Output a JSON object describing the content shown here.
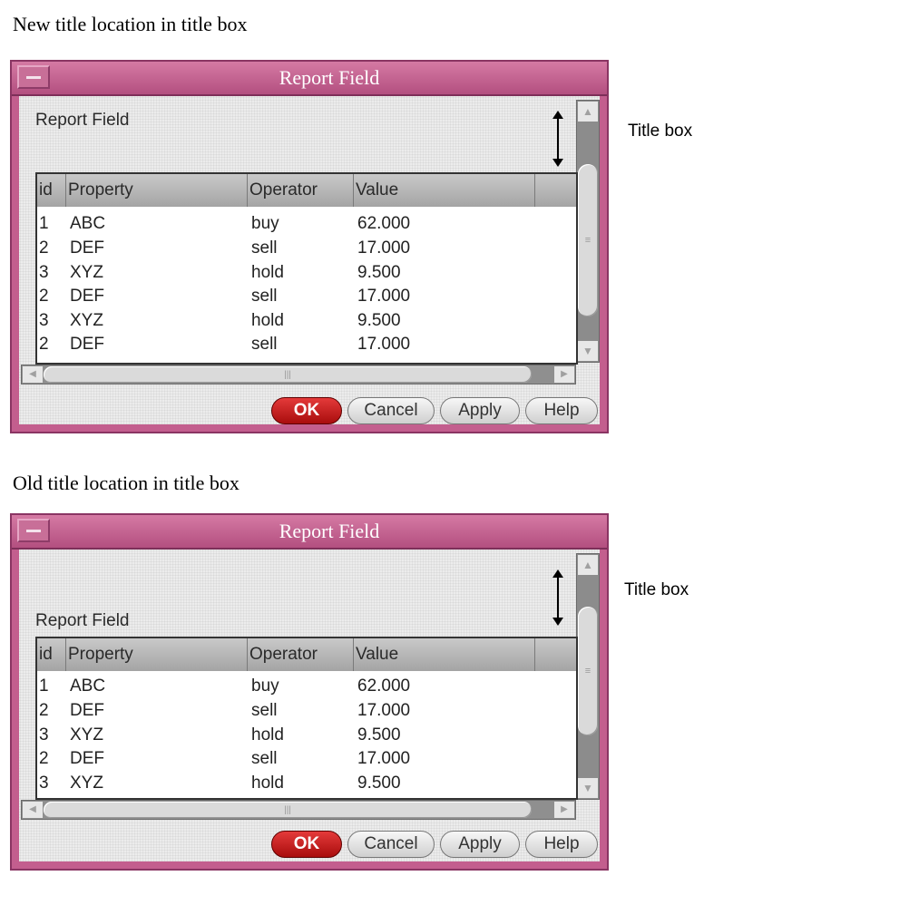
{
  "top": {
    "caption": "New title location in title box",
    "side_label": "Title box",
    "window_title": "Report Field",
    "report_label": "Report Field",
    "columns": [
      "id",
      "Property",
      "Operator",
      "Value"
    ],
    "rows": [
      [
        "1",
        "ABC",
        "buy",
        "62.000"
      ],
      [
        "2",
        "DEF",
        "sell",
        "17.000"
      ],
      [
        "3",
        "XYZ",
        "hold",
        "9.500"
      ],
      [
        "2",
        "DEF",
        "sell",
        "17.000"
      ],
      [
        "3",
        "XYZ",
        "hold",
        "9.500"
      ],
      [
        "2",
        "DEF",
        "sell",
        "17.000"
      ]
    ],
    "buttons": {
      "ok": "OK",
      "cancel": "Cancel",
      "apply": "Apply",
      "help": "Help"
    }
  },
  "bottom": {
    "caption": "Old title location in title box",
    "side_label": "Title box",
    "window_title": "Report Field",
    "report_label": "Report Field",
    "columns": [
      "id",
      "Property",
      "Operator",
      "Value"
    ],
    "rows": [
      [
        "1",
        "ABC",
        "buy",
        "62.000"
      ],
      [
        "2",
        "DEF",
        "sell",
        "17.000"
      ],
      [
        "3",
        "XYZ",
        "hold",
        "9.500"
      ],
      [
        "2",
        "DEF",
        "sell",
        "17.000"
      ],
      [
        "3",
        "XYZ",
        "hold",
        "9.500"
      ]
    ],
    "buttons": {
      "ok": "OK",
      "cancel": "Cancel",
      "apply": "Apply",
      "help": "Help"
    }
  },
  "colors": {
    "window_frame": "#c35e8e",
    "ok_button": "#c41e1e",
    "background": "#ececec"
  },
  "icons": [
    "window-menu-icon",
    "double-headed-arrow-icon",
    "scroll-up-icon",
    "scroll-down-icon",
    "scroll-left-icon",
    "scroll-right-icon"
  ]
}
